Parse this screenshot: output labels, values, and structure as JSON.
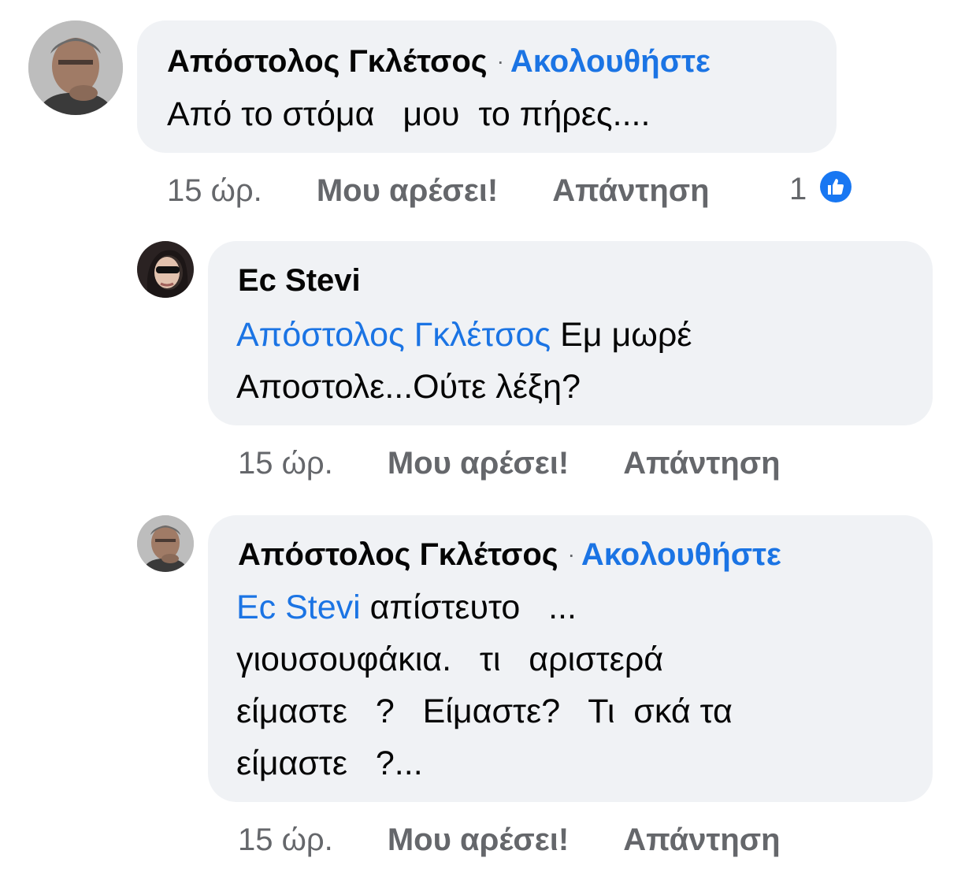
{
  "comments": [
    {
      "author": "Απόστολος Γκλέτσος",
      "separator": "·",
      "follow_label": "Ακολουθήστε",
      "text_line1": "Από το στόμα   μου  το πήρες....",
      "time": "15 ώρ.",
      "like_label": "Μου αρέσει!",
      "reply_label": "Απάντηση",
      "reaction_count": "1",
      "reaction_icon": "thumbs-up-icon"
    },
    {
      "author": "Ec Stevi",
      "mention": "Απόστολος Γκλέτσος",
      "text_line1_rest": " Εμ μωρέ",
      "text_line2": "Αποστολε...Ούτε λέξη?",
      "time": "15 ώρ.",
      "like_label": "Μου αρέσει!",
      "reply_label": "Απάντηση"
    },
    {
      "author": "Απόστολος Γκλέτσος",
      "separator": "·",
      "follow_label": "Ακολουθήστε",
      "mention": "Ec Stevi",
      "text_line1_rest": " απίστευτο   ...",
      "text_line2": "γιουσουφάκια.   τι   αριστερά",
      "text_line3": "είμαστε   ?   Είμαστε?   Τι  σκά τα",
      "text_line4": "είμαστε   ?...",
      "time": "15 ώρ.",
      "like_label": "Μου αρέσει!",
      "reply_label": "Απάντηση"
    }
  ],
  "colors": {
    "bubble_bg": "#f0f2f5",
    "link_blue": "#1b74e4",
    "meta_gray": "#65676b",
    "like_blue": "#1877f2"
  }
}
